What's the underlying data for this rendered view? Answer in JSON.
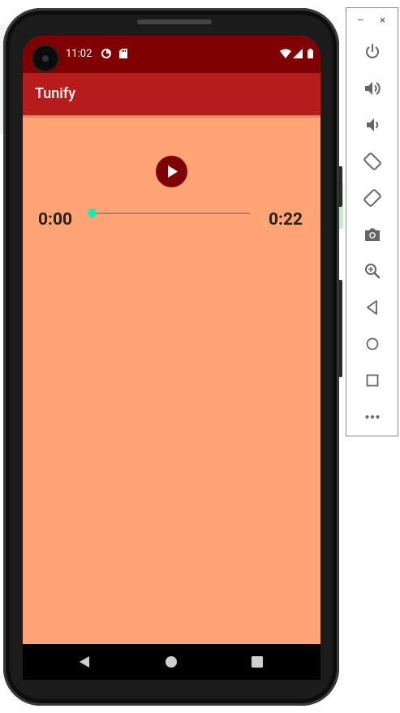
{
  "status_bar": {
    "time": "11:02",
    "background": "#7f0000"
  },
  "app": {
    "title": "Tunify",
    "app_bar_color": "#b71c1c",
    "background": "#ffa474"
  },
  "player": {
    "elapsed": "0:00",
    "duration": "0:22",
    "progress": 0,
    "accent": "#1de9b6",
    "button_icon": "play-icon"
  },
  "navigation": [
    "back-icon",
    "home-icon",
    "recents-icon"
  ],
  "emulator_panel": {
    "window_controls": [
      "–",
      "×"
    ],
    "tools": [
      "power-icon",
      "volume-up-icon",
      "volume-down-icon",
      "rotate-left-icon",
      "rotate-right-icon",
      "camera-icon",
      "zoom-icon",
      "back-icon",
      "home-icon",
      "overview-icon",
      "more-icon"
    ]
  }
}
